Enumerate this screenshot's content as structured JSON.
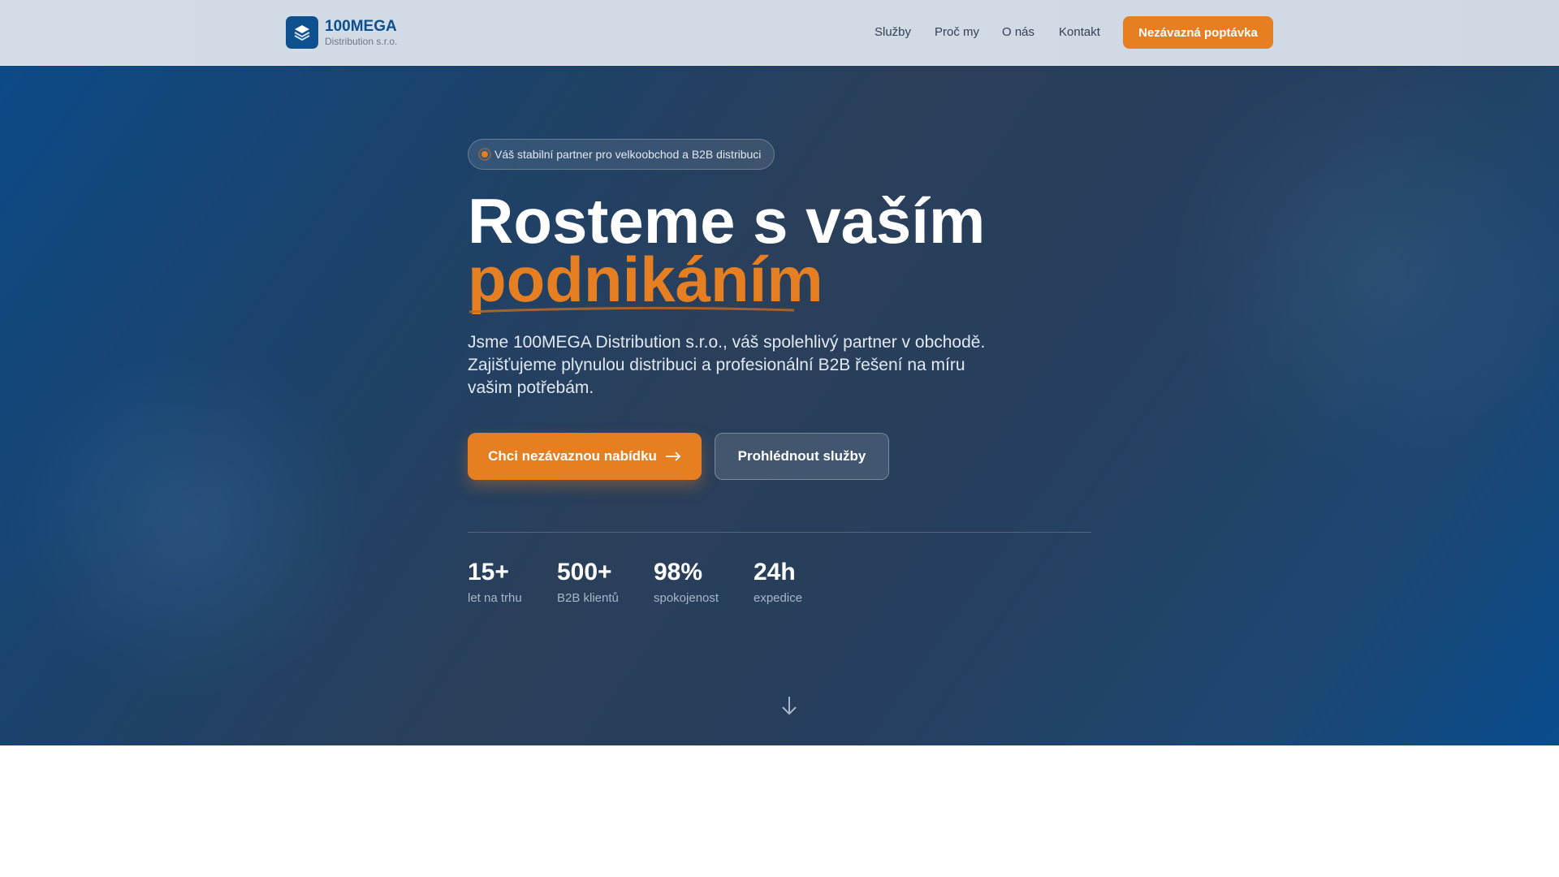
{
  "header": {
    "brand_title": "100MEGA",
    "brand_subtitle": "Distribution s.r.o.",
    "nav": [
      "Služby",
      "Proč my",
      "O nás",
      "Kontakt"
    ],
    "cta": "Nezávazná poptávka"
  },
  "hero": {
    "badge": "Váš stabilní partner pro velkoobchod a B2B distribuci",
    "headline_1": "Rosteme s vaším",
    "headline_2": "podnikáním",
    "paragraph": "Jsme 100MEGA Distribution s.r.o., váš spolehlivý partner v obchodě. Zajišťujeme plynulou distribuci a profesionální B2B řešení na míru vašim potřebám.",
    "primary_button": "Chci nezávaznou nabídku",
    "secondary_button": "Prohlédnout služby",
    "stats": [
      {
        "value": "15+",
        "label": "let na trhu"
      },
      {
        "value": "500+",
        "label": "B2B klientů"
      },
      {
        "value": "98%",
        "label": "spokojenost"
      },
      {
        "value": "24h",
        "label": "expedice"
      }
    ]
  },
  "colors": {
    "accent": "#e67e22",
    "brand": "#0e4f8d"
  }
}
